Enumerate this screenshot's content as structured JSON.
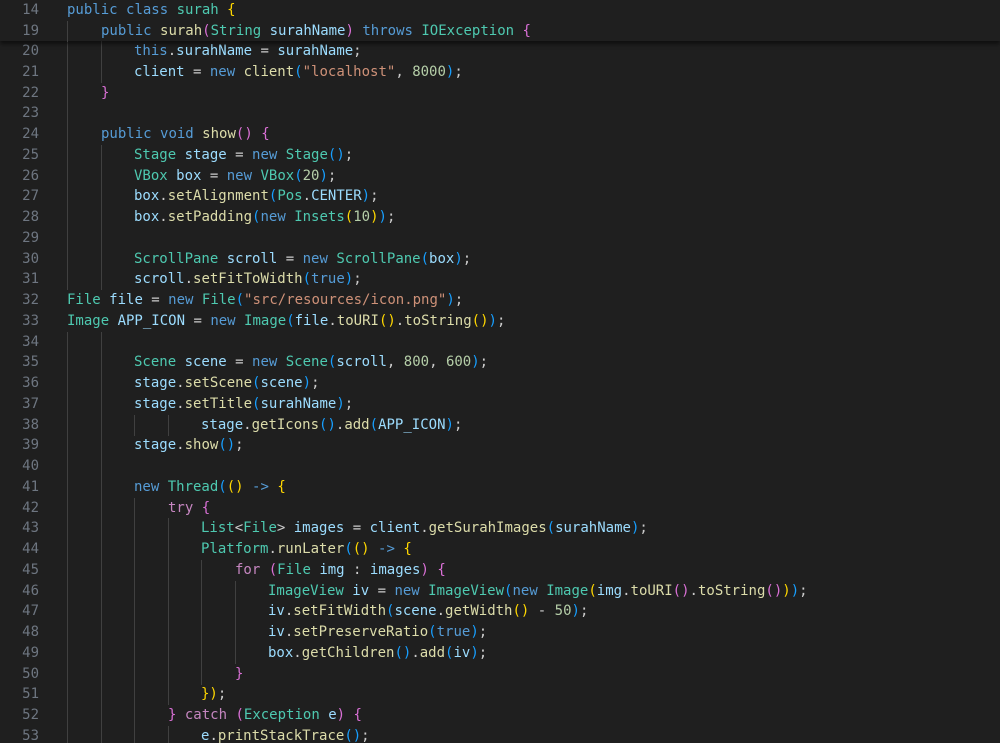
{
  "editor": {
    "language": "java",
    "theme": {
      "background": "#1f1f1f",
      "line_number": "#6e7681",
      "keyword": "#569cd6",
      "control": "#c586c0",
      "identifier": "#9cdcfe",
      "type": "#4ec9b0",
      "function": "#dcdcaa",
      "string": "#ce9178",
      "number": "#b5cea8",
      "bracket_1": "#ffd700",
      "bracket_2": "#da70d6",
      "bracket_3": "#179fff"
    },
    "sticky_lines": [
      {
        "n": "14",
        "indent": 0,
        "tokens": [
          [
            "kw",
            "public "
          ],
          [
            "kw",
            "class "
          ],
          [
            "ty",
            "surah "
          ],
          [
            "b1",
            "{"
          ]
        ]
      },
      {
        "n": "19",
        "indent": 1,
        "tokens": [
          [
            "kw",
            "public "
          ],
          [
            "fn",
            "surah"
          ],
          [
            "b2",
            "("
          ],
          [
            "ty",
            "String "
          ],
          [
            "id",
            "surahName"
          ],
          [
            "b2",
            ")"
          ],
          [
            "kw",
            " throws "
          ],
          [
            "ty",
            "IOException "
          ],
          [
            "b2",
            "{"
          ]
        ]
      }
    ],
    "lines": [
      {
        "n": "20",
        "indent": 2,
        "tokens": [
          [
            "kw",
            "this"
          ],
          [
            "pl",
            "."
          ],
          [
            "id",
            "surahName"
          ],
          [
            "pl",
            " = "
          ],
          [
            "id",
            "surahName"
          ],
          [
            "pl",
            ";"
          ]
        ]
      },
      {
        "n": "21",
        "indent": 2,
        "tokens": [
          [
            "id",
            "client"
          ],
          [
            "pl",
            " = "
          ],
          [
            "kw",
            "new "
          ],
          [
            "fn",
            "client"
          ],
          [
            "b3",
            "("
          ],
          [
            "str",
            "\"localhost\""
          ],
          [
            "pl",
            ", "
          ],
          [
            "num",
            "8000"
          ],
          [
            "b3",
            ")"
          ],
          [
            "pl",
            ";"
          ]
        ]
      },
      {
        "n": "22",
        "indent": 1,
        "tokens": [
          [
            "b2",
            "}"
          ]
        ]
      },
      {
        "n": "23",
        "indent": 1,
        "tokens": []
      },
      {
        "n": "24",
        "indent": 1,
        "tokens": [
          [
            "kw",
            "public "
          ],
          [
            "kw",
            "void "
          ],
          [
            "fn",
            "show"
          ],
          [
            "b2",
            "()"
          ],
          [
            "pl",
            " "
          ],
          [
            "b2",
            "{"
          ]
        ]
      },
      {
        "n": "25",
        "indent": 2,
        "tokens": [
          [
            "ty",
            "Stage "
          ],
          [
            "id",
            "stage"
          ],
          [
            "pl",
            " = "
          ],
          [
            "kw",
            "new "
          ],
          [
            "ty",
            "Stage"
          ],
          [
            "b3",
            "()"
          ],
          [
            "pl",
            ";"
          ]
        ]
      },
      {
        "n": "26",
        "indent": 2,
        "tokens": [
          [
            "ty",
            "VBox "
          ],
          [
            "id",
            "box"
          ],
          [
            "pl",
            " = "
          ],
          [
            "kw",
            "new "
          ],
          [
            "ty",
            "VBox"
          ],
          [
            "b3",
            "("
          ],
          [
            "num",
            "20"
          ],
          [
            "b3",
            ")"
          ],
          [
            "pl",
            ";"
          ]
        ]
      },
      {
        "n": "27",
        "indent": 2,
        "tokens": [
          [
            "id",
            "box"
          ],
          [
            "pl",
            "."
          ],
          [
            "fn",
            "setAlignment"
          ],
          [
            "b3",
            "("
          ],
          [
            "ty",
            "Pos"
          ],
          [
            "pl",
            "."
          ],
          [
            "id",
            "CENTER"
          ],
          [
            "b3",
            ")"
          ],
          [
            "pl",
            ";"
          ]
        ]
      },
      {
        "n": "28",
        "indent": 2,
        "tokens": [
          [
            "id",
            "box"
          ],
          [
            "pl",
            "."
          ],
          [
            "fn",
            "setPadding"
          ],
          [
            "b3",
            "("
          ],
          [
            "kw",
            "new "
          ],
          [
            "ty",
            "Insets"
          ],
          [
            "b1",
            "("
          ],
          [
            "num",
            "10"
          ],
          [
            "b1",
            ")"
          ],
          [
            "b3",
            ")"
          ],
          [
            "pl",
            ";"
          ]
        ]
      },
      {
        "n": "29",
        "indent": 2,
        "tokens": []
      },
      {
        "n": "30",
        "indent": 2,
        "tokens": [
          [
            "ty",
            "ScrollPane "
          ],
          [
            "id",
            "scroll"
          ],
          [
            "pl",
            " = "
          ],
          [
            "kw",
            "new "
          ],
          [
            "ty",
            "ScrollPane"
          ],
          [
            "b3",
            "("
          ],
          [
            "id",
            "box"
          ],
          [
            "b3",
            ")"
          ],
          [
            "pl",
            ";"
          ]
        ]
      },
      {
        "n": "31",
        "indent": 2,
        "tokens": [
          [
            "id",
            "scroll"
          ],
          [
            "pl",
            "."
          ],
          [
            "fn",
            "setFitToWidth"
          ],
          [
            "b3",
            "("
          ],
          [
            "kw",
            "true"
          ],
          [
            "b3",
            ")"
          ],
          [
            "pl",
            ";"
          ]
        ]
      },
      {
        "n": "32",
        "indent": 0,
        "tokens": [
          [
            "ty",
            "File "
          ],
          [
            "id",
            "file"
          ],
          [
            "pl",
            " = "
          ],
          [
            "kw",
            "new "
          ],
          [
            "ty",
            "File"
          ],
          [
            "b3",
            "("
          ],
          [
            "str",
            "\"src/resources/icon.png\""
          ],
          [
            "b3",
            ")"
          ],
          [
            "pl",
            ";"
          ]
        ]
      },
      {
        "n": "33",
        "indent": 0,
        "tokens": [
          [
            "ty",
            "Image "
          ],
          [
            "id",
            "APP_ICON"
          ],
          [
            "pl",
            " = "
          ],
          [
            "kw",
            "new "
          ],
          [
            "ty",
            "Image"
          ],
          [
            "b3",
            "("
          ],
          [
            "id",
            "file"
          ],
          [
            "pl",
            "."
          ],
          [
            "fn",
            "toURI"
          ],
          [
            "b1",
            "()"
          ],
          [
            "pl",
            "."
          ],
          [
            "fn",
            "toString"
          ],
          [
            "b1",
            "()"
          ],
          [
            "b3",
            ")"
          ],
          [
            "pl",
            ";"
          ]
        ]
      },
      {
        "n": "34",
        "indent": 2,
        "tokens": []
      },
      {
        "n": "35",
        "indent": 2,
        "tokens": [
          [
            "ty",
            "Scene "
          ],
          [
            "id",
            "scene"
          ],
          [
            "pl",
            " = "
          ],
          [
            "kw",
            "new "
          ],
          [
            "ty",
            "Scene"
          ],
          [
            "b3",
            "("
          ],
          [
            "id",
            "scroll"
          ],
          [
            "pl",
            ", "
          ],
          [
            "num",
            "800"
          ],
          [
            "pl",
            ", "
          ],
          [
            "num",
            "600"
          ],
          [
            "b3",
            ")"
          ],
          [
            "pl",
            ";"
          ]
        ]
      },
      {
        "n": "36",
        "indent": 2,
        "tokens": [
          [
            "id",
            "stage"
          ],
          [
            "pl",
            "."
          ],
          [
            "fn",
            "setScene"
          ],
          [
            "b3",
            "("
          ],
          [
            "id",
            "scene"
          ],
          [
            "b3",
            ")"
          ],
          [
            "pl",
            ";"
          ]
        ]
      },
      {
        "n": "37",
        "indent": 2,
        "tokens": [
          [
            "id",
            "stage"
          ],
          [
            "pl",
            "."
          ],
          [
            "fn",
            "setTitle"
          ],
          [
            "b3",
            "("
          ],
          [
            "id",
            "surahName"
          ],
          [
            "b3",
            ")"
          ],
          [
            "pl",
            ";"
          ]
        ]
      },
      {
        "n": "38",
        "indent": 4,
        "tokens": [
          [
            "id",
            "stage"
          ],
          [
            "pl",
            "."
          ],
          [
            "fn",
            "getIcons"
          ],
          [
            "b3",
            "()"
          ],
          [
            "pl",
            "."
          ],
          [
            "fn",
            "add"
          ],
          [
            "b3",
            "("
          ],
          [
            "id",
            "APP_ICON"
          ],
          [
            "b3",
            ")"
          ],
          [
            "pl",
            ";"
          ]
        ]
      },
      {
        "n": "39",
        "indent": 2,
        "tokens": [
          [
            "id",
            "stage"
          ],
          [
            "pl",
            "."
          ],
          [
            "fn",
            "show"
          ],
          [
            "b3",
            "()"
          ],
          [
            "pl",
            ";"
          ]
        ]
      },
      {
        "n": "40",
        "indent": 2,
        "tokens": []
      },
      {
        "n": "41",
        "indent": 2,
        "tokens": [
          [
            "kw",
            "new "
          ],
          [
            "ty",
            "Thread"
          ],
          [
            "b3",
            "("
          ],
          [
            "b1",
            "()"
          ],
          [
            "pl",
            " "
          ],
          [
            "kw",
            "->"
          ],
          [
            "pl",
            " "
          ],
          [
            "b1",
            "{"
          ]
        ]
      },
      {
        "n": "42",
        "indent": 3,
        "tokens": [
          [
            "ctl",
            "try "
          ],
          [
            "b2",
            "{"
          ]
        ]
      },
      {
        "n": "43",
        "indent": 4,
        "tokens": [
          [
            "ty",
            "List"
          ],
          [
            "pl",
            "<"
          ],
          [
            "ty",
            "File"
          ],
          [
            "pl",
            "> "
          ],
          [
            "id",
            "images"
          ],
          [
            "pl",
            " = "
          ],
          [
            "id",
            "client"
          ],
          [
            "pl",
            "."
          ],
          [
            "fn",
            "getSurahImages"
          ],
          [
            "b3",
            "("
          ],
          [
            "id",
            "surahName"
          ],
          [
            "b3",
            ")"
          ],
          [
            "pl",
            ";"
          ]
        ]
      },
      {
        "n": "44",
        "indent": 4,
        "tokens": [
          [
            "ty",
            "Platform"
          ],
          [
            "pl",
            "."
          ],
          [
            "fn",
            "runLater"
          ],
          [
            "b3",
            "("
          ],
          [
            "b1",
            "()"
          ],
          [
            "pl",
            " "
          ],
          [
            "kw",
            "->"
          ],
          [
            "pl",
            " "
          ],
          [
            "b1",
            "{"
          ]
        ]
      },
      {
        "n": "45",
        "indent": 5,
        "tokens": [
          [
            "ctl",
            "for "
          ],
          [
            "b2",
            "("
          ],
          [
            "ty",
            "File "
          ],
          [
            "id",
            "img"
          ],
          [
            "pl",
            " : "
          ],
          [
            "id",
            "images"
          ],
          [
            "b2",
            ")"
          ],
          [
            "pl",
            " "
          ],
          [
            "b2",
            "{"
          ]
        ]
      },
      {
        "n": "46",
        "indent": 6,
        "tokens": [
          [
            "ty",
            "ImageView "
          ],
          [
            "id",
            "iv"
          ],
          [
            "pl",
            " = "
          ],
          [
            "kw",
            "new "
          ],
          [
            "ty",
            "ImageView"
          ],
          [
            "b3",
            "("
          ],
          [
            "kw",
            "new "
          ],
          [
            "ty",
            "Image"
          ],
          [
            "b1",
            "("
          ],
          [
            "id",
            "img"
          ],
          [
            "pl",
            "."
          ],
          [
            "fn",
            "toURI"
          ],
          [
            "b2",
            "()"
          ],
          [
            "pl",
            "."
          ],
          [
            "fn",
            "toString"
          ],
          [
            "b2",
            "()"
          ],
          [
            "b1",
            ")"
          ],
          [
            "b3",
            ")"
          ],
          [
            "pl",
            ";"
          ]
        ]
      },
      {
        "n": "47",
        "indent": 6,
        "tokens": [
          [
            "id",
            "iv"
          ],
          [
            "pl",
            "."
          ],
          [
            "fn",
            "setFitWidth"
          ],
          [
            "b3",
            "("
          ],
          [
            "id",
            "scene"
          ],
          [
            "pl",
            "."
          ],
          [
            "fn",
            "getWidth"
          ],
          [
            "b1",
            "()"
          ],
          [
            "pl",
            " - "
          ],
          [
            "num",
            "50"
          ],
          [
            "b3",
            ")"
          ],
          [
            "pl",
            ";"
          ]
        ]
      },
      {
        "n": "48",
        "indent": 6,
        "tokens": [
          [
            "id",
            "iv"
          ],
          [
            "pl",
            "."
          ],
          [
            "fn",
            "setPreserveRatio"
          ],
          [
            "b3",
            "("
          ],
          [
            "kw",
            "true"
          ],
          [
            "b3",
            ")"
          ],
          [
            "pl",
            ";"
          ]
        ]
      },
      {
        "n": "49",
        "indent": 6,
        "tokens": [
          [
            "id",
            "box"
          ],
          [
            "pl",
            "."
          ],
          [
            "fn",
            "getChildren"
          ],
          [
            "b3",
            "()"
          ],
          [
            "pl",
            "."
          ],
          [
            "fn",
            "add"
          ],
          [
            "b3",
            "("
          ],
          [
            "id",
            "iv"
          ],
          [
            "b3",
            ")"
          ],
          [
            "pl",
            ";"
          ]
        ]
      },
      {
        "n": "50",
        "indent": 5,
        "tokens": [
          [
            "b2",
            "}"
          ]
        ]
      },
      {
        "n": "51",
        "indent": 4,
        "tokens": [
          [
            "b1",
            "})"
          ],
          [
            "pl",
            ";"
          ]
        ]
      },
      {
        "n": "52",
        "indent": 3,
        "tokens": [
          [
            "b2",
            "}"
          ],
          [
            "pl",
            " "
          ],
          [
            "ctl",
            "catch "
          ],
          [
            "b2",
            "("
          ],
          [
            "ty",
            "Exception "
          ],
          [
            "id",
            "e"
          ],
          [
            "b2",
            ")"
          ],
          [
            "pl",
            " "
          ],
          [
            "b2",
            "{"
          ]
        ]
      },
      {
        "n": "53",
        "indent": 4,
        "tokens": [
          [
            "id",
            "e"
          ],
          [
            "pl",
            "."
          ],
          [
            "fn",
            "printStackTrace"
          ],
          [
            "b3",
            "()"
          ],
          [
            "pl",
            ";"
          ]
        ]
      }
    ]
  }
}
